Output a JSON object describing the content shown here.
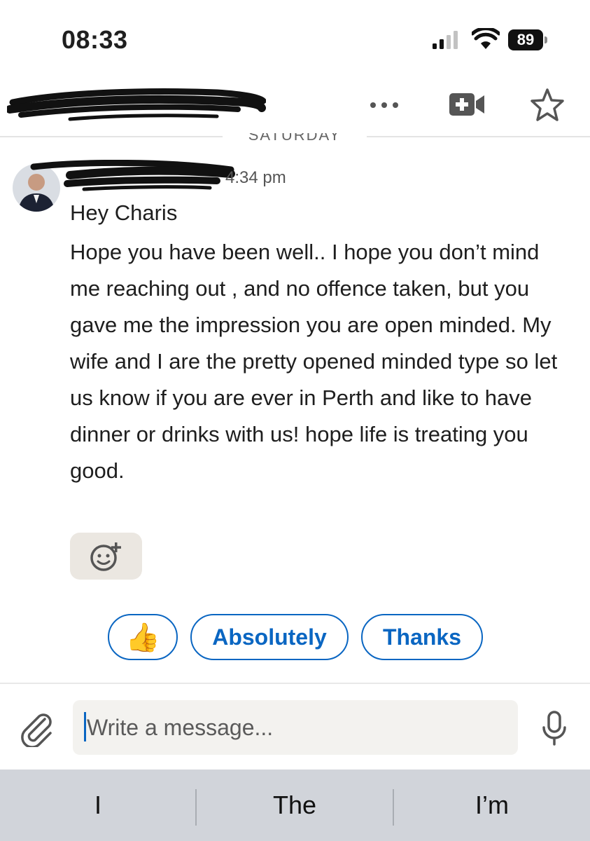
{
  "status_bar": {
    "time": "08:33",
    "battery": "89"
  },
  "header": {
    "contact_name": ""
  },
  "day_divider": "SATURDAY",
  "message": {
    "time": "4:34 pm",
    "greeting": "Hey Charis",
    "body": "Hope you have been well.. I hope you don’t mind me reaching out , and no offence taken, but you gave me the impression you are open minded. My wife and I are the pretty opened minded type so let us know if you are ever in Perth and like to have dinner or drinks with us! hope life is treating you good."
  },
  "quick_replies": {
    "thumbs_up": "👍",
    "absolutely": "Absolutely",
    "thanks": "Thanks"
  },
  "composer": {
    "placeholder": "Write a message..."
  },
  "keyboard_suggestions": {
    "s1": "I",
    "s2": "The",
    "s3": "I’m"
  },
  "colors": {
    "accent": "#0a66c2",
    "reaction_bg": "#ebe7e1",
    "input_bg": "#f3f2ef",
    "keyboard_bg": "#d1d4da"
  }
}
